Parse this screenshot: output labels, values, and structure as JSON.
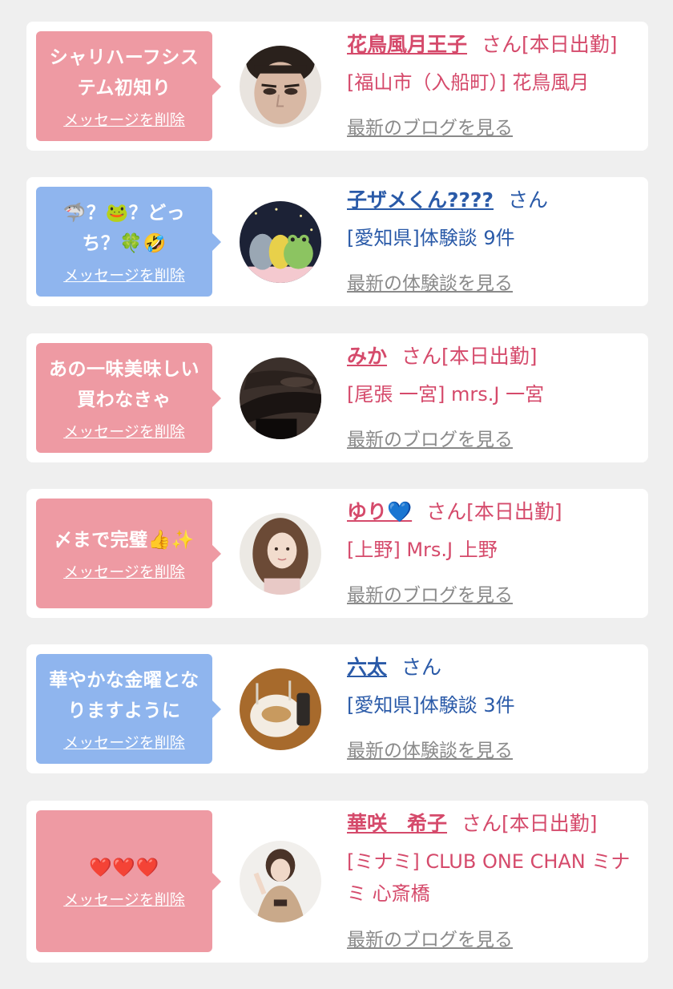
{
  "colors": {
    "pink_bubble": "#ee9aa3",
    "blue_bubble": "#8fb5ee",
    "pink_text": "#d54a6b",
    "blue_text": "#2a5aa8",
    "link_gray": "#8a8a8a"
  },
  "entries": [
    {
      "message_line1": "シャリハーフシス",
      "message_line2": "テム初知り",
      "delete_label": "メッセージを削除",
      "name": "花鳥風月王子",
      "suffix": "さん[本日出勤]",
      "sub": "[福山市（入船町）] 花鳥風月",
      "more": "最新のブログを見る"
    },
    {
      "message_line1": "🦈？🐸？どっ",
      "message_line2": "ち？🍀🤣",
      "delete_label": "メッセージを削除",
      "name": "子ザメくん????",
      "suffix": "さん",
      "sub": "[愛知県]体験談 9件",
      "more": "最新の体験談を見る"
    },
    {
      "message_line1": "あの一味美味しい",
      "message_line2": "買わなきゃ",
      "delete_label": "メッセージを削除",
      "name": "みか",
      "suffix": "さん[本日出勤]",
      "sub": "[尾張 一宮] mrs.J 一宮",
      "more": "最新のブログを見る"
    },
    {
      "message_line1": "〆まで完璧👍✨",
      "delete_label": "メッセージを削除",
      "name": "ゆり💙",
      "suffix": "さん[本日出勤]",
      "sub": "[上野] Mrs.J 上野",
      "more": "最新のブログを見る"
    },
    {
      "message_line1": "華やかな金曜とな",
      "message_line2": "りますように",
      "delete_label": "メッセージを削除",
      "name": "六太",
      "suffix": "さん",
      "sub": "[愛知県]体験談 3件",
      "more": "最新の体験談を見る"
    },
    {
      "message_line1": "❤️❤️❤️",
      "delete_label": "メッセージを削除",
      "name": "華咲　希子",
      "suffix": "さん[本日出勤]",
      "sub": "[ミナミ] CLUB ONE CHAN ミナミ 心斎橋",
      "more": "最新のブログを見る"
    }
  ],
  "avatars": [
    "man-face-photo",
    "plush-toys-photo",
    "legs-stockings-photo",
    "woman-portrait-photo",
    "food-plate-photo",
    "woman-posing-photo"
  ]
}
